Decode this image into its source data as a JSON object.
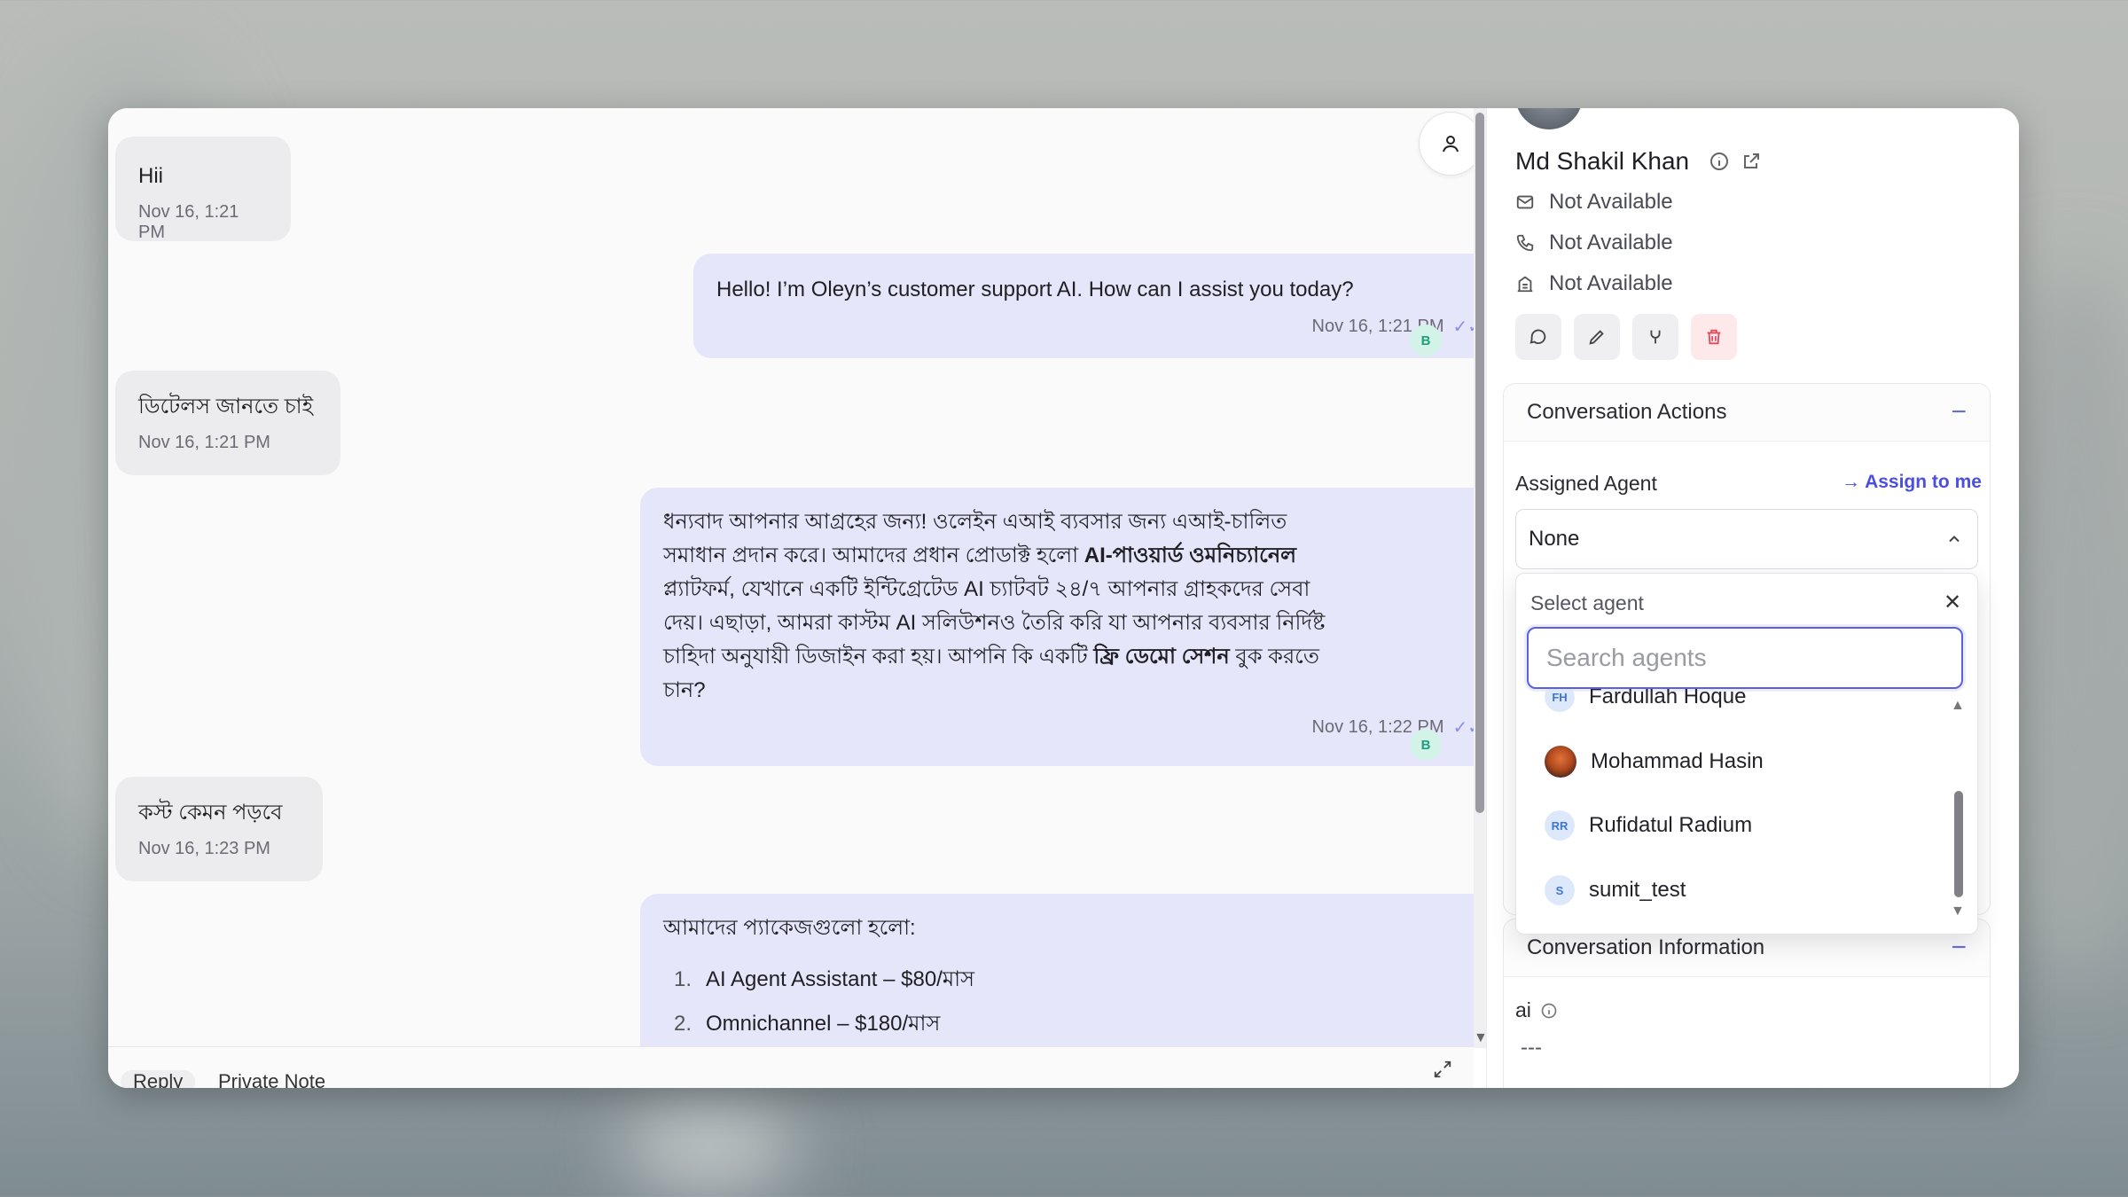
{
  "chat": {
    "messages": [
      {
        "dir": "in",
        "text": "Hii",
        "time": "Nov 16, 1:21 PM"
      },
      {
        "dir": "out",
        "text": "Hello! I’m Oleyn’s customer support AI. How can I assist you today?",
        "time": "Nov 16, 1:21 PM"
      },
      {
        "dir": "in",
        "text": "ডিটেলস জানতে চাই",
        "time": "Nov 16, 1:21 PM"
      },
      {
        "dir": "out",
        "line1": "ধন্যবাদ আপনার আগ্রহের জন্য! ওলেইন এআই ব্যবসার জন্য এআই-চালিত",
        "line2a": "সমাধান প্রদান করে। আমাদের প্রধান প্রোডাক্ট হলো ",
        "line2b": "AI-পাওয়ার্ড ওমনিচ্যানেল",
        "line3": "প্ল্যাটফর্ম, যেখানে একটি ইন্টিগ্রেটেড AI চ্যাটবট ২৪/৭ আপনার গ্রাহকদের সেবা",
        "line4": "দেয়। এছাড়া, আমরা কাস্টম AI সলিউশনও তৈরি করি যা আপনার ব্যবসার নির্দিষ্ট",
        "line5a": "চাহিদা অনুযায়ী ডিজাইন করা হয়। আপনি কি একটি ",
        "line5b": "ফ্রি ডেমো সেশন",
        "line5c": " বুক করতে",
        "line6": "চান?",
        "time": "Nov 16, 1:22 PM"
      },
      {
        "dir": "in",
        "text": "কস্ট কেমন পড়বে",
        "time": "Nov 16, 1:23 PM"
      },
      {
        "dir": "out",
        "text": "আমাদের প্যাকেজগুলো হলো:",
        "items": [
          {
            "num": "1.",
            "text": "AI Agent Assistant – $80/মাস"
          },
          {
            "num": "2.",
            "text": "Omnichannel – $180/মাস"
          }
        ]
      }
    ],
    "bot_initial": "B",
    "tabs": {
      "reply": "Reply",
      "private_note": "Private Note"
    }
  },
  "contact": {
    "name": "Md Shakil Khan",
    "email": "Not Available",
    "phone": "Not Available",
    "company": "Not Available"
  },
  "conversation_actions": {
    "title": "Conversation Actions",
    "assigned_agent_label": "Assigned Agent",
    "assign_to_me": "Assign to me",
    "selected_agent": "None",
    "dropdown": {
      "title": "Select agent",
      "search_placeholder": "Search agents",
      "agents": [
        {
          "name": "Fardullah Hoque",
          "initials": "FH"
        },
        {
          "name": "Mohammad Hasin",
          "initials": ""
        },
        {
          "name": "Rufidatul Radium",
          "initials": "RR"
        },
        {
          "name": "sumit_test",
          "initials": "S"
        }
      ]
    }
  },
  "conversation_information": {
    "title": "Conversation Information",
    "field_label": "ai",
    "field_value": "---"
  },
  "colors": {
    "accent": "#5b5fe4",
    "outgoing_bubble": "#e6e6fb",
    "incoming_bubble": "#ececee"
  }
}
